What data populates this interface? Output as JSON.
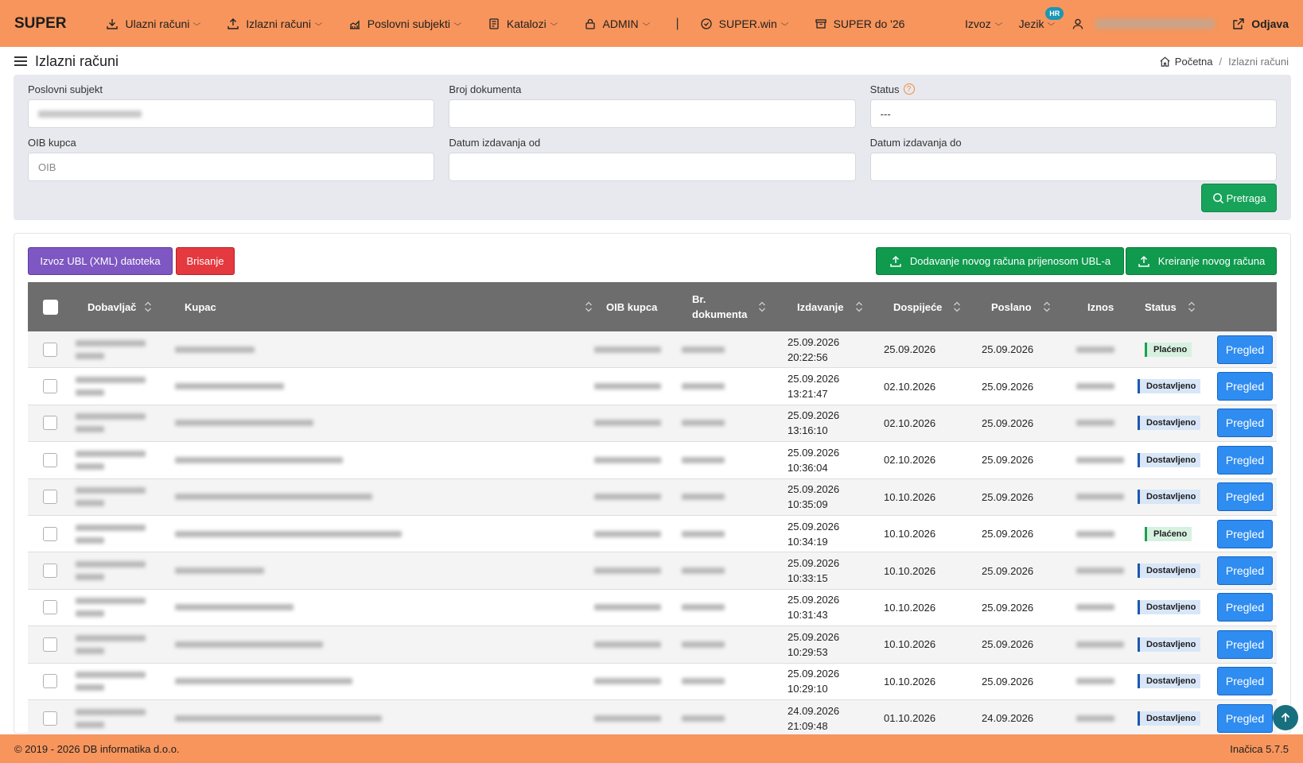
{
  "nav": {
    "brand": "SUPER",
    "items": [
      {
        "label": "Ulazni računi",
        "icon": "download-icon"
      },
      {
        "label": "Izlazni računi",
        "icon": "upload-icon"
      },
      {
        "label": "Poslovni subjekti",
        "icon": "chart-icon"
      },
      {
        "label": "Katalozi",
        "icon": "catalog-icon"
      },
      {
        "label": "ADMIN",
        "icon": "lock-icon"
      },
      {
        "label": "SUPER.win",
        "icon": "check-badge-icon"
      },
      {
        "label": "SUPER do '26",
        "icon": "archive-icon"
      }
    ],
    "export_label": "Izvoz",
    "language_label": "Jezik",
    "language_badge": "HR",
    "logout_label": "Odjava"
  },
  "page": {
    "title": "Izlazni računi",
    "breadcrumb_home": "Početna",
    "breadcrumb_current": "Izlazni računi"
  },
  "filters": {
    "business_subject_label": "Poslovni subjekt",
    "document_number_label": "Broj dokumenta",
    "status_label": "Status",
    "status_value": "---",
    "buyer_oib_label": "OIB kupca",
    "buyer_oib_placeholder": "OIB",
    "date_from_label": "Datum izdavanja od",
    "date_to_label": "Datum izdavanja do",
    "search_label": "Pretraga"
  },
  "toolbar": {
    "export_ubl_label": "Izvoz UBL (XML) datoteka",
    "delete_label": "Brisanje",
    "add_ubl_label": "Dodavanje novog računa prijenosom UBL-a",
    "create_label": "Kreiranje novog računa"
  },
  "table": {
    "headers": {
      "supplier": "Dobavljač",
      "buyer": "Kupac",
      "buyer_oib": "OIB kupca",
      "doc_no_line1": "Br.",
      "doc_no_line2": "dokumenta",
      "issued": "Izdavanje",
      "due": "Dospijeće",
      "sent": "Poslano",
      "amount": "Iznos",
      "status": "Status"
    },
    "view_label": "Pregled",
    "rows": [
      {
        "issued_date": "25.09.2026",
        "issued_time": "20:22:56",
        "due": "25.09.2026",
        "sent": "25.09.2026",
        "status": "Plaćeno",
        "kind": "paid"
      },
      {
        "issued_date": "25.09.2026",
        "issued_time": "13:21:47",
        "due": "02.10.2026",
        "sent": "25.09.2026",
        "status": "Dostavljeno",
        "kind": "sent"
      },
      {
        "issued_date": "25.09.2026",
        "issued_time": "13:16:10",
        "due": "02.10.2026",
        "sent": "25.09.2026",
        "status": "Dostavljeno",
        "kind": "sent"
      },
      {
        "issued_date": "25.09.2026",
        "issued_time": "10:36:04",
        "due": "02.10.2026",
        "sent": "25.09.2026",
        "status": "Dostavljeno",
        "kind": "sent"
      },
      {
        "issued_date": "25.09.2026",
        "issued_time": "10:35:09",
        "due": "10.10.2026",
        "sent": "25.09.2026",
        "status": "Dostavljeno",
        "kind": "sent"
      },
      {
        "issued_date": "25.09.2026",
        "issued_time": "10:34:19",
        "due": "10.10.2026",
        "sent": "25.09.2026",
        "status": "Plaćeno",
        "kind": "paid"
      },
      {
        "issued_date": "25.09.2026",
        "issued_time": "10:33:15",
        "due": "10.10.2026",
        "sent": "25.09.2026",
        "status": "Dostavljeno",
        "kind": "sent"
      },
      {
        "issued_date": "25.09.2026",
        "issued_time": "10:31:43",
        "due": "10.10.2026",
        "sent": "25.09.2026",
        "status": "Dostavljeno",
        "kind": "sent"
      },
      {
        "issued_date": "25.09.2026",
        "issued_time": "10:29:53",
        "due": "10.10.2026",
        "sent": "25.09.2026",
        "status": "Dostavljeno",
        "kind": "sent"
      },
      {
        "issued_date": "25.09.2026",
        "issued_time": "10:29:10",
        "due": "10.10.2026",
        "sent": "25.09.2026",
        "status": "Dostavljeno",
        "kind": "sent"
      },
      {
        "issued_date": "24.09.2026",
        "issued_time": "21:09:48",
        "due": "01.10.2026",
        "sent": "24.09.2026",
        "status": "Dostavljeno",
        "kind": "sent"
      }
    ]
  },
  "footer": {
    "copyright": "© 2019 - 2026 DB informatika d.o.o.",
    "version": "Inačica 5.7.5"
  },
  "colors": {
    "header_bg": "#f7955c",
    "table_header_bg": "#6d6d6d",
    "primary_blue": "#2f8cf0",
    "success_green": "#0f9a4e",
    "danger_red": "#e4393f",
    "purple": "#7e57c2"
  }
}
